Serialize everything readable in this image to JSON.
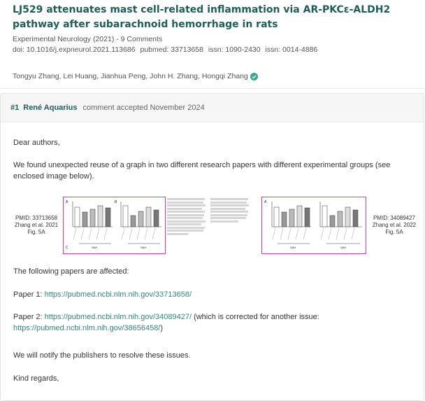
{
  "paper": {
    "title": "LJ529 attenuates mast cell-related inflammation via AR-PKCε-ALDH2 pathway after subarachnoid hemorrhage in rats",
    "journal": "Experimental Neurology (2021)",
    "comments": "9 Comments",
    "doi": "doi: 10.1016/j.expneurol.2021.113686",
    "pubmed": "pubmed: 33713658",
    "issn1": "issn: 1090-2430",
    "issn2": "issn: 0014-4886",
    "authors": "Tongyu Zhang, Lei Huang, Jianhua Peng, John H. Zhang, Hongqi Zhang"
  },
  "comment": {
    "number": "#1",
    "author": "René Aquarius",
    "status": "comment accepted November 2024",
    "greeting": "Dear authors,",
    "intro": "We found unexpected reuse of a graph in two different research papers with different experimental groups (see enclosed image below).",
    "figure": {
      "left_label": "PMID: 33713658\nZhang et al. 2021\nFig. 5A",
      "right_label": "PMID: 34089427\nZhang et al. 2022\nFig. 5A",
      "left_panel_a": "A",
      "left_panel_b": "B",
      "left_panel_c": "C",
      "left_group": "SAH",
      "right_panel_a": "A",
      "right_group": "SAH"
    },
    "affected": "The following papers are affected:",
    "paper1_label": "Paper 1: ",
    "paper1_link": "https://pubmed.ncbi.nlm.nih.gov/33713658/",
    "paper2_label": "Paper 2: ",
    "paper2_link": "https://pubmed.ncbi.nlm.nih.gov/34089427/",
    "paper2_note": " (which is corrected for another issue: ",
    "paper2_link2": "https://pubmed.ncbi.nlm.nih.gov/38656458/",
    "paper2_close": ")",
    "notify": "We will notify the publishers to resolve these issues.",
    "regards": "Kind regards,"
  },
  "colors": {
    "accent": "#1f5e56",
    "link": "#2d8a7a",
    "highlight_box": "#d43ca9"
  },
  "icons": {
    "verified": "check-circle-icon"
  }
}
